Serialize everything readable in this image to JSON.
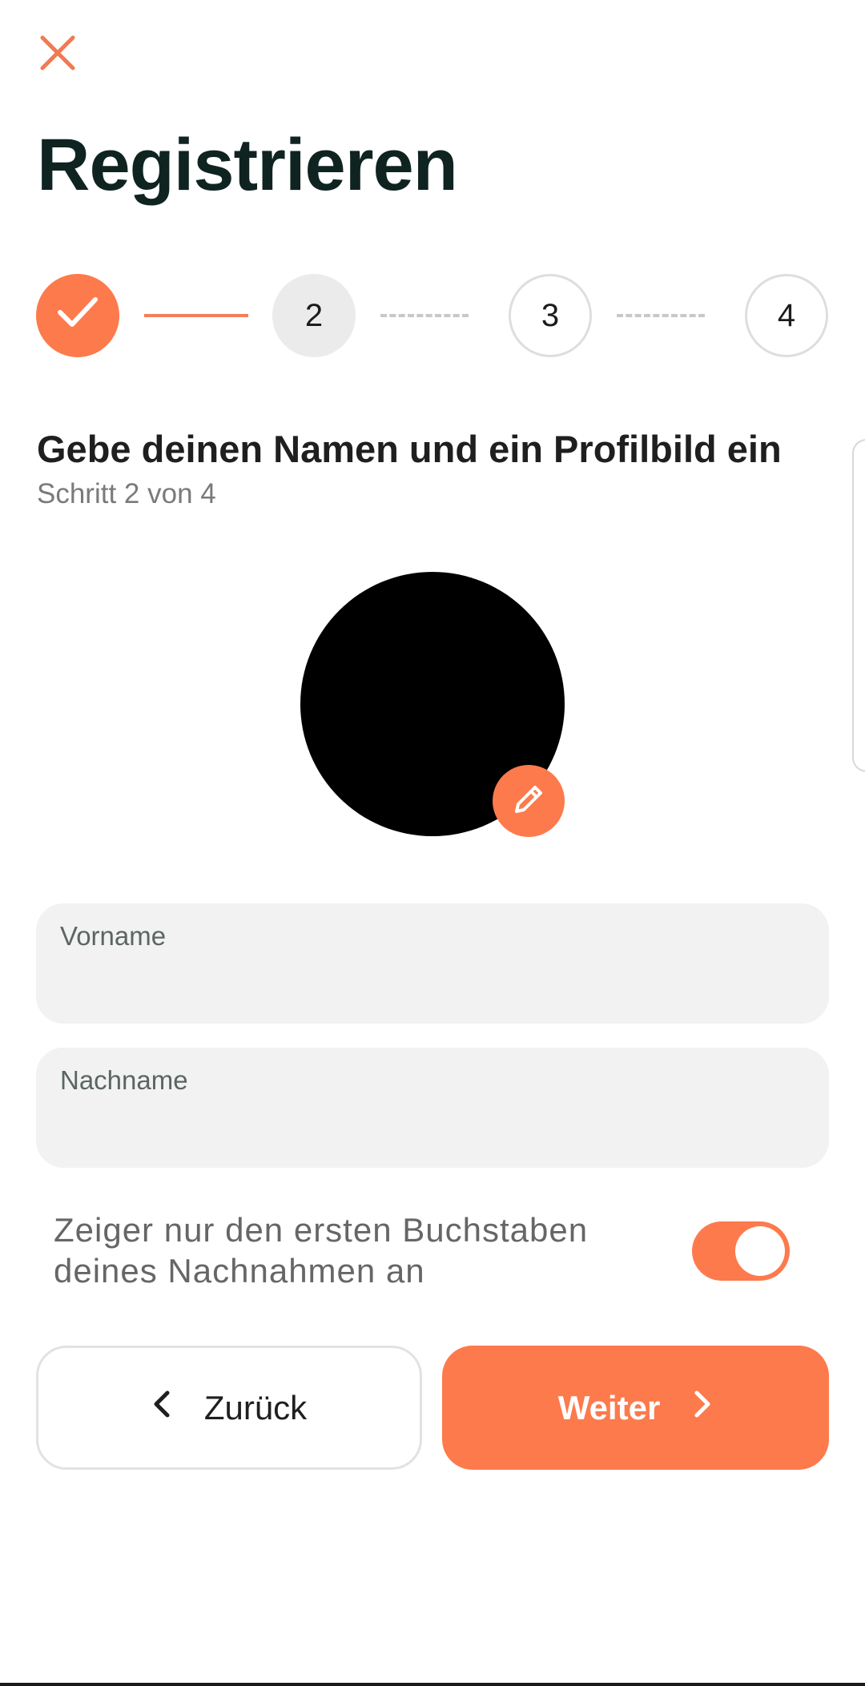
{
  "page": {
    "title": "Registrieren"
  },
  "stepper": {
    "steps": [
      {
        "label": "",
        "state": "completed"
      },
      {
        "label": "2",
        "state": "current"
      },
      {
        "label": "3",
        "state": "upcoming"
      },
      {
        "label": "4",
        "state": "upcoming"
      }
    ]
  },
  "section": {
    "heading": "Gebe deinen Namen und ein Profilbild ein",
    "subheading": "Schritt 2 von 4"
  },
  "avatar": {
    "edit_icon": "pencil-icon"
  },
  "form": {
    "first_name_label": "Vorname",
    "first_name_value": "",
    "last_name_label": "Nachname",
    "last_name_value": ""
  },
  "privacy": {
    "toggle_label": "Zeiger nur den ersten Buchstaben deines Nachnahmen an",
    "toggle_on": true
  },
  "actions": {
    "back_label": "Zurück",
    "next_label": "Weiter"
  },
  "colors": {
    "accent": "#fd7a4c",
    "title": "#0f2420",
    "field_bg": "#f2f2f2"
  },
  "icons": {
    "close": "close-icon",
    "check": "check-icon",
    "back": "chevron-left-icon",
    "next": "chevron-right-icon"
  }
}
